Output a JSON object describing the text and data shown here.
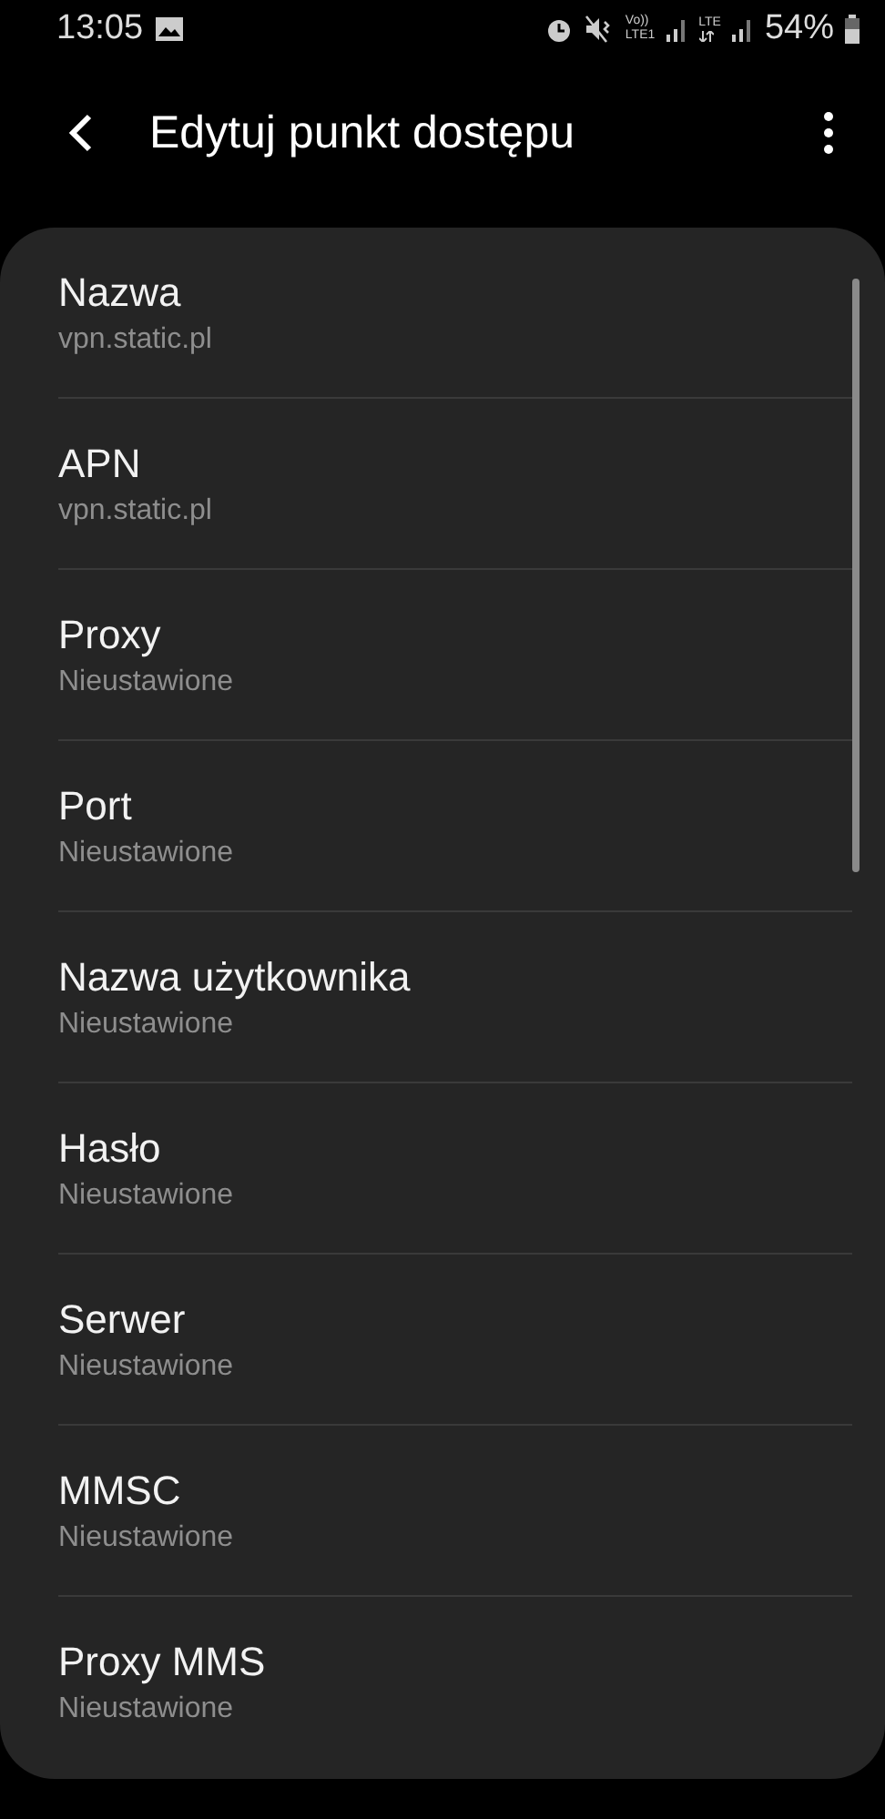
{
  "status_bar": {
    "time": "13:05",
    "volte_top": "Vo))",
    "volte_bottom": "LTE1",
    "lte": "LTE",
    "battery_text": "54%"
  },
  "header": {
    "title": "Edytuj punkt dostępu"
  },
  "items": [
    {
      "title": "Nazwa",
      "value": "vpn.static.pl"
    },
    {
      "title": "APN",
      "value": "vpn.static.pl"
    },
    {
      "title": "Proxy",
      "value": "Nieustawione"
    },
    {
      "title": "Port",
      "value": "Nieustawione"
    },
    {
      "title": "Nazwa użytkownika",
      "value": "Nieustawione"
    },
    {
      "title": "Hasło",
      "value": "Nieustawione"
    },
    {
      "title": "Serwer",
      "value": "Nieustawione"
    },
    {
      "title": "MMSC",
      "value": "Nieustawione"
    },
    {
      "title": "Proxy MMS",
      "value": "Nieustawione"
    }
  ]
}
